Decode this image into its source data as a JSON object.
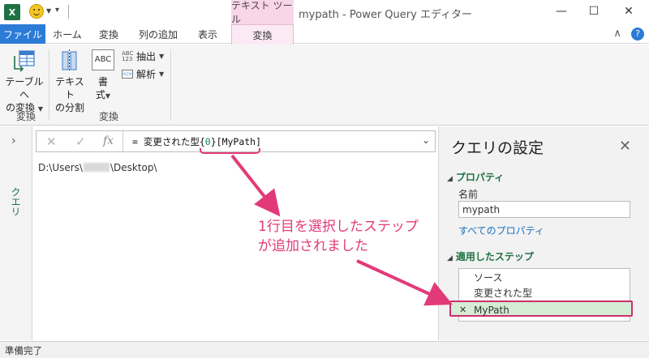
{
  "titlebar": {
    "logo_text": "X",
    "tool_tab_header": "テキスト ツール",
    "window_title": "mypath - Power Query エディター",
    "minimize": "—",
    "maximize": "☐",
    "close": "✕"
  },
  "tabs": {
    "file": "ファイル",
    "home": "ホーム",
    "transform": "変換",
    "add_column": "列の追加",
    "view": "表示",
    "transform_ctx": "変換",
    "collapse": "∧",
    "help": "?"
  },
  "ribbon": {
    "table_convert": [
      "テーブルへ",
      "の変換"
    ],
    "group1_label": "変換",
    "split_text": [
      "テキスト",
      "の分割"
    ],
    "format": [
      "書",
      "式"
    ],
    "extract": "抽出",
    "parse": "解析",
    "group2_label": "変換",
    "abc_icon": "ABC",
    "abc123_icon": "ABC\n123"
  },
  "query_pane": {
    "expand": "›",
    "label": "クエリ"
  },
  "formula_bar": {
    "cancel": "✕",
    "commit": "✓",
    "fx": "fx",
    "prefix": "= 変更された型{",
    "index": "0",
    "suffix": "}[MyPath]",
    "dropdown": "⌄"
  },
  "cell": {
    "before": "D:\\Users\\",
    "after": "\\Desktop\\"
  },
  "settings": {
    "title": "クエリの設定",
    "close": "✕",
    "properties_header": "プロパティ",
    "name_label": "名前",
    "name_value": "mypath",
    "all_properties": "すべてのプロパティ",
    "steps_header": "適用したステップ",
    "steps": [
      "ソース",
      "変更された型",
      "MyPath"
    ],
    "active_step_marker": "✕"
  },
  "status": "準備完了",
  "annotation": {
    "line1": "1行目を選択したステップ",
    "line2": "が追加されました",
    "color": "#e23a78"
  }
}
